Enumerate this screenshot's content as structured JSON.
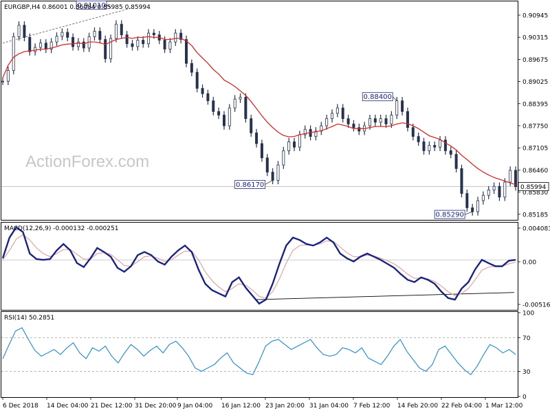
{
  "chart_data": [
    {
      "type": "candlestick",
      "panel": "price",
      "symbol_label": "EURGBP,H4",
      "ohlc_label": "0.86001 0.86084 0.85985 0.85994",
      "yaxis_ticks": [
        "0.90945",
        "0.90315",
        "0.89675",
        "0.89025",
        "0.88395",
        "0.87750",
        "0.87105",
        "0.86460",
        "0.85830",
        "0.85185"
      ],
      "ylim": [
        0.8508,
        0.9117
      ],
      "last_price": "0.85994",
      "watermark": "ActionForex.com",
      "annotations": [
        {
          "label": "0.91010",
          "value": 0.9101
        },
        {
          "label": "0.86170",
          "value": 0.8617
        },
        {
          "label": "0.88400",
          "value": 0.884
        },
        {
          "label": "0.85290",
          "value": 0.8529
        }
      ],
      "series": [
        {
          "name": "EURGBP H4",
          "color": "#26324e",
          "closes": [
            0.8895,
            0.8925,
            0.902,
            0.9052,
            0.9018,
            0.8978,
            0.899,
            0.9002,
            0.8985,
            0.9005,
            0.9021,
            0.9032,
            0.9018,
            0.8992,
            0.9005,
            0.8988,
            0.902,
            0.9035,
            0.9012,
            0.8958,
            0.9015,
            0.9055,
            0.9025,
            0.9,
            0.8992,
            0.901,
            0.9,
            0.903,
            0.9025,
            0.901,
            0.8985,
            0.9005,
            0.903,
            0.9012,
            0.8945,
            0.892,
            0.8875,
            0.886,
            0.884,
            0.881,
            0.88,
            0.877,
            0.882,
            0.8845,
            0.885,
            0.879,
            0.875,
            0.872,
            0.868,
            0.864,
            0.8617,
            0.866,
            0.87,
            0.8725,
            0.871,
            0.8745,
            0.876,
            0.874,
            0.8755,
            0.877,
            0.879,
            0.8805,
            0.882,
            0.879,
            0.8775,
            0.8765,
            0.8755,
            0.877,
            0.879,
            0.878,
            0.879,
            0.8775,
            0.88,
            0.884,
            0.881,
            0.8765,
            0.874,
            0.8725,
            0.87,
            0.8715,
            0.871,
            0.873,
            0.87,
            0.869,
            0.865,
            0.858,
            0.854,
            0.8529,
            0.856,
            0.8575,
            0.859,
            0.86,
            0.857,
            0.8612,
            0.8645,
            0.8599
          ],
          "ma_name": "MA",
          "ma_color": "#d42a2a",
          "ma": [
            0.8905,
            0.894,
            0.8962,
            0.8972,
            0.8978,
            0.898,
            0.8982,
            0.8985,
            0.8985,
            0.8988,
            0.8992,
            0.8997,
            0.8999,
            0.9,
            0.9002,
            0.9,
            0.9005,
            0.9005,
            0.9003,
            0.8998,
            0.9005,
            0.9012,
            0.9015,
            0.9018,
            0.9015,
            0.9018,
            0.9018,
            0.902,
            0.9018,
            0.9018,
            0.9012,
            0.9012,
            0.9015,
            0.9015,
            0.9008,
            0.8995,
            0.8975,
            0.896,
            0.8945,
            0.8928,
            0.8915,
            0.8898,
            0.889,
            0.888,
            0.8868,
            0.8855,
            0.8838,
            0.8818,
            0.8798,
            0.878,
            0.8765,
            0.8752,
            0.8743,
            0.8739,
            0.874,
            0.8745,
            0.8748,
            0.8751,
            0.8753,
            0.8756,
            0.8762,
            0.8768,
            0.8775,
            0.8772,
            0.8768,
            0.8762,
            0.8762,
            0.8762,
            0.8765,
            0.8768,
            0.8768,
            0.8768,
            0.877,
            0.8775,
            0.8778,
            0.8776,
            0.877,
            0.8762,
            0.8752,
            0.8742,
            0.8737,
            0.8732,
            0.8722,
            0.8713,
            0.8702,
            0.8687,
            0.8675,
            0.8662,
            0.865,
            0.864,
            0.8632,
            0.8625,
            0.862,
            0.8615,
            0.861,
            0.8605
          ]
        }
      ],
      "trendline": {
        "from": 0.9002,
        "to": 0.9101
      }
    },
    {
      "type": "line",
      "panel": "macd",
      "label": "MACD(12,26,9) -0.000132 -0.000251",
      "yaxis_ticks": [
        "0.004083",
        "0.00",
        "-0.005169"
      ],
      "ylim": [
        -0.0062,
        0.0046
      ],
      "series": [
        {
          "name": "MACD",
          "color": "#1a237e",
          "values": [
            0.0002,
            0.0028,
            0.0041,
            0.0035,
            0.0008,
            0.0001,
            0.0,
            0.0001,
            0.0012,
            0.002,
            0.0012,
            -0.0004,
            -0.0009,
            0.0002,
            0.0015,
            0.001,
            0.0004,
            -0.001,
            -0.0015,
            -0.0008,
            0.0006,
            0.001,
            0.0006,
            -0.0002,
            -0.0006,
            0.0004,
            0.0012,
            0.0018,
            0.001,
            -0.0012,
            -0.003,
            -0.0038,
            -0.0042,
            -0.0046,
            -0.0028,
            -0.0022,
            -0.0035,
            -0.0045,
            -0.0055,
            -0.005,
            -0.003,
            -0.0005,
            0.0018,
            0.0028,
            0.0025,
            0.002,
            0.0018,
            0.0022,
            0.0028,
            0.0022,
            0.0008,
            0.0002,
            -0.0002,
            0.0004,
            0.0008,
            0.0004,
            0.0,
            -0.0005,
            -0.001,
            -0.0018,
            -0.0025,
            -0.0028,
            -0.0022,
            -0.0025,
            -0.003,
            -0.004,
            -0.0048,
            -0.005,
            -0.0036,
            -0.0028,
            -0.0012,
            0.0,
            -0.0004,
            -0.0008,
            -0.0008,
            -0.0001,
            0.0
          ]
        },
        {
          "name": "Signal",
          "color": "#e0a4a4",
          "values": [
            0.0,
            0.0012,
            0.0026,
            0.0032,
            0.0025,
            0.0015,
            0.0008,
            0.0004,
            0.0008,
            0.0013,
            0.0013,
            0.0007,
            0.0001,
            0.0001,
            0.0008,
            0.0009,
            0.0007,
            0.0,
            -0.0007,
            -0.0008,
            -0.0002,
            0.0004,
            0.0005,
            0.0002,
            -0.0002,
            0.0,
            0.0006,
            0.0011,
            0.0011,
            0.0,
            -0.0015,
            -0.0026,
            -0.0034,
            -0.004,
            -0.0036,
            -0.003,
            -0.0032,
            -0.0038,
            -0.0046,
            -0.0048,
            -0.004,
            -0.0024,
            -0.0004,
            0.0012,
            0.0018,
            0.0019,
            0.0018,
            0.002,
            0.0024,
            0.0023,
            0.0016,
            0.0009,
            0.0004,
            0.0004,
            0.0006,
            0.0005,
            0.0002,
            -0.0001,
            -0.0005,
            -0.0011,
            -0.0018,
            -0.0023,
            -0.0023,
            -0.0024,
            -0.0027,
            -0.0033,
            -0.004,
            -0.0045,
            -0.0042,
            -0.0036,
            -0.0025,
            -0.0013,
            -0.0009,
            -0.0008,
            -0.0008,
            -0.0005,
            -0.0003
          ]
        }
      ],
      "trendline": {
        "from": -0.005,
        "to": -0.0041
      }
    },
    {
      "type": "line",
      "panel": "rsi",
      "label": "RSI(14) 50.2851",
      "yaxis_ticks": [
        "100",
        "70",
        "30",
        "0"
      ],
      "ylim": [
        0,
        100
      ],
      "levels": [
        70,
        30
      ],
      "series": [
        {
          "name": "RSI",
          "color": "#2e8fd0",
          "values": [
            45,
            62,
            78,
            82,
            68,
            55,
            48,
            52,
            56,
            50,
            58,
            64,
            52,
            45,
            58,
            54,
            60,
            48,
            40,
            52,
            62,
            56,
            48,
            55,
            60,
            52,
            62,
            66,
            58,
            48,
            34,
            30,
            34,
            38,
            46,
            52,
            40,
            34,
            28,
            26,
            42,
            60,
            66,
            68,
            62,
            56,
            60,
            64,
            68,
            58,
            50,
            48,
            50,
            58,
            56,
            52,
            58,
            46,
            42,
            38,
            48,
            60,
            68,
            54,
            44,
            34,
            30,
            38,
            56,
            60,
            50,
            40,
            32,
            26,
            36,
            50,
            62,
            58,
            52,
            56,
            50
          ]
        }
      ]
    }
  ],
  "xaxis": {
    "labels": [
      "6 Dec 2018",
      "14 Dec 04:00",
      "21 Dec 12:00",
      "31 Dec 20:00",
      "9 Jan 04:00",
      "16 Jan 12:00",
      "23 Jan 20:00",
      "31 Jan 04:00",
      "7 Feb 12:00",
      "14 Feb 20:00",
      "22 Feb 04:00",
      "1 Mar 12:00"
    ]
  }
}
